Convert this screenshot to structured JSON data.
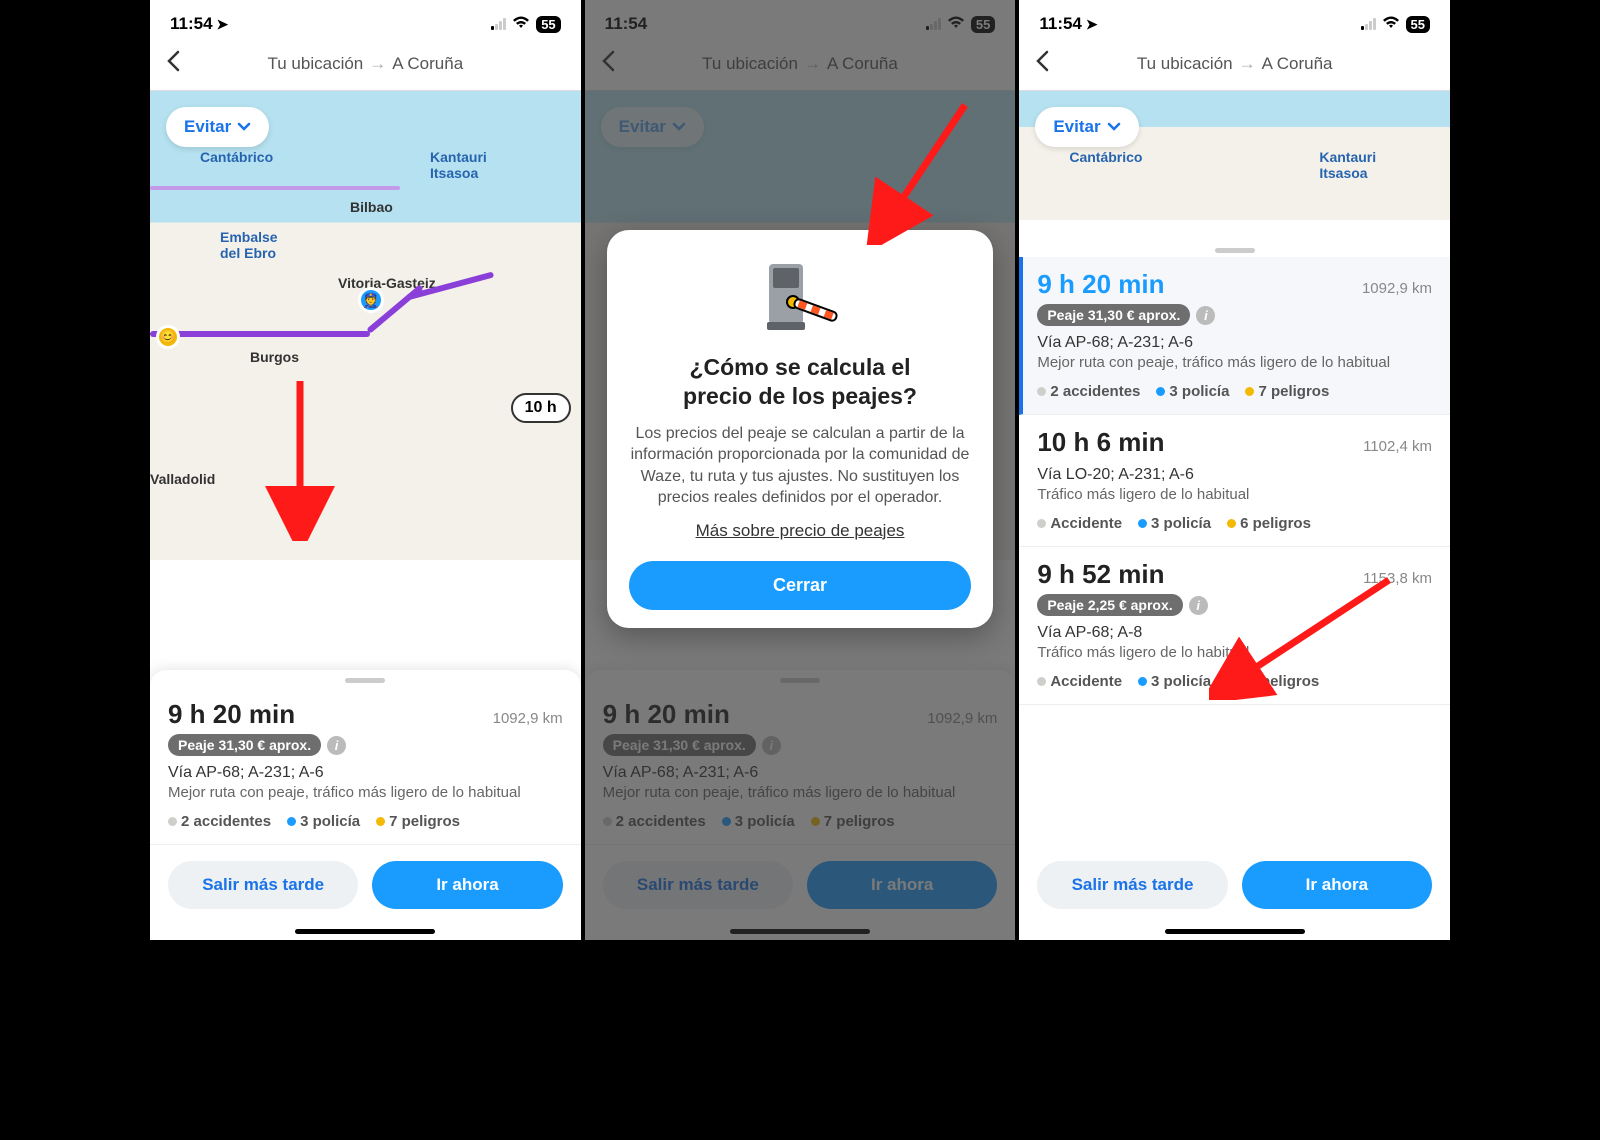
{
  "status_bar": {
    "time": "11:54",
    "battery": "55"
  },
  "header": {
    "from": "Tu ubicación",
    "to": "A Coruña"
  },
  "avoid_label": "Evitar",
  "map_labels": {
    "cantabrico": "Cantábrico",
    "kantauri": "Kantauri\nItsasoa",
    "bilbao": "Bilbao",
    "embalse": "Embalse\ndel Ebro",
    "vitoria": "Vitoria-Gasteiz",
    "burgos": "Burgos",
    "valladolid": "Valladolid"
  },
  "map_time_badge": "10 h",
  "screen1_route": {
    "time": "9 h 20 min",
    "dist": "1092,9 km",
    "toll": "Peaje 31,30 € aprox.",
    "via": "Vía AP-68; A-231; A-6",
    "desc": "Mejor ruta con peaje, tráfico más ligero de lo habitual",
    "t1": "2 accidentes",
    "t2": "3 policía",
    "t3": "7 peligros"
  },
  "modal": {
    "title_l1": "¿Cómo se calcula el",
    "title_l2": "precio de los peajes?",
    "body": "Los precios del peaje se calculan a partir de la información proporcionada por la comunidad de Waze, tu ruta y tus ajustes. No sustituyen los precios reales definidos por el operador.",
    "link": "Más sobre precio de peajes",
    "close": "Cerrar"
  },
  "screen3": {
    "r1": {
      "time": "9 h 20 min",
      "dist": "1092,9 km",
      "toll": "Peaje 31,30 € aprox.",
      "via": "Vía AP-68; A-231; A-6",
      "desc": "Mejor ruta con peaje, tráfico más ligero de lo habitual",
      "t1": "2 accidentes",
      "t2": "3 policía",
      "t3": "7 peligros"
    },
    "r2": {
      "time": "10 h 6 min",
      "dist": "1102,4 km",
      "via": "Vía LO-20; A-231; A-6",
      "desc": "Tráfico más ligero de lo habitual",
      "t1": "Accidente",
      "t2": "3 policía",
      "t3": "6 peligros"
    },
    "r3": {
      "time": "9 h 52 min",
      "dist": "1153,8 km",
      "toll": "Peaje 2,25 € aprox.",
      "via": "Vía AP-68; A-8",
      "desc": "Tráfico más ligero de lo habitual",
      "t1": "Accidente",
      "t2": "3 policía",
      "t3": "13 peligros"
    }
  },
  "actions": {
    "later": "Salir más tarde",
    "go": "Ir ahora"
  }
}
